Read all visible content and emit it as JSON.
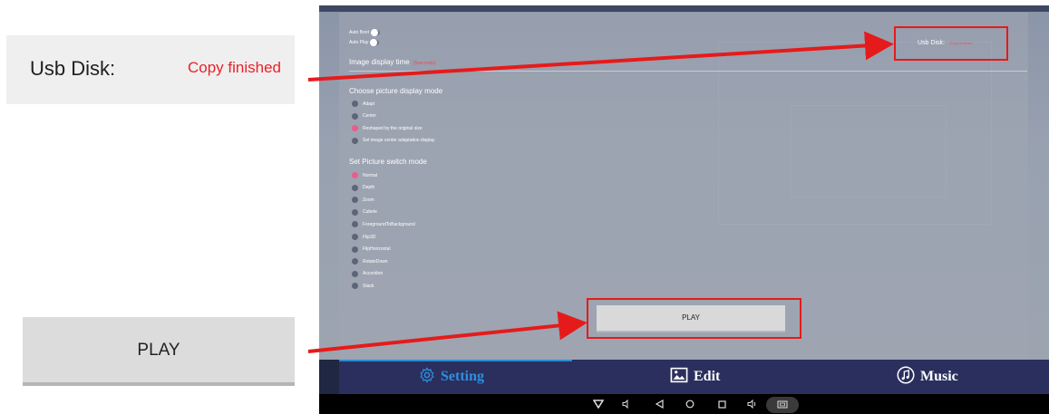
{
  "callouts": {
    "usb_label": "Usb Disk:",
    "usb_value": "Copy finished",
    "play_label": "PLAY"
  },
  "settings": {
    "auto_boot_label": "Auto Boot",
    "auto_play_label": "Auto Play",
    "image_display_time_label": "Image display time",
    "image_display_time_value": "(5seconds)",
    "display_mode_title": "Choose picture display mode",
    "display_modes": [
      {
        "label": "Adapt",
        "selected": false
      },
      {
        "label": "Center",
        "selected": false
      },
      {
        "label": "Reshaped by the original size",
        "selected": true
      },
      {
        "label": "Set image center adaptation display",
        "selected": false
      }
    ],
    "switch_mode_title": "Set Picture switch mode",
    "switch_modes": [
      {
        "label": "Normal",
        "selected": true
      },
      {
        "label": "Depth",
        "selected": false
      },
      {
        "label": "Zoom",
        "selected": false
      },
      {
        "label": "Cubele",
        "selected": false
      },
      {
        "label": "ForegroundToBackground",
        "selected": false
      },
      {
        "label": "Flip3D",
        "selected": false
      },
      {
        "label": "FlipHorizontal",
        "selected": false
      },
      {
        "label": "RotateDown",
        "selected": false
      },
      {
        "label": "Accordion",
        "selected": false
      },
      {
        "label": "Stack",
        "selected": false
      }
    ],
    "usb_label": "Usb Disk:",
    "usb_value": "Copy finished",
    "play_label": "PLAY"
  },
  "tabs": [
    {
      "label": "Setting",
      "icon": "gear-icon",
      "active": true
    },
    {
      "label": "Edit",
      "icon": "image-icon",
      "active": false
    },
    {
      "label": "Music",
      "icon": "music-note-icon",
      "active": false
    }
  ],
  "colors": {
    "accent_red": "#e51b1b",
    "tab_active": "#2a8bd6",
    "selected_radio": "#ec5c8a"
  }
}
